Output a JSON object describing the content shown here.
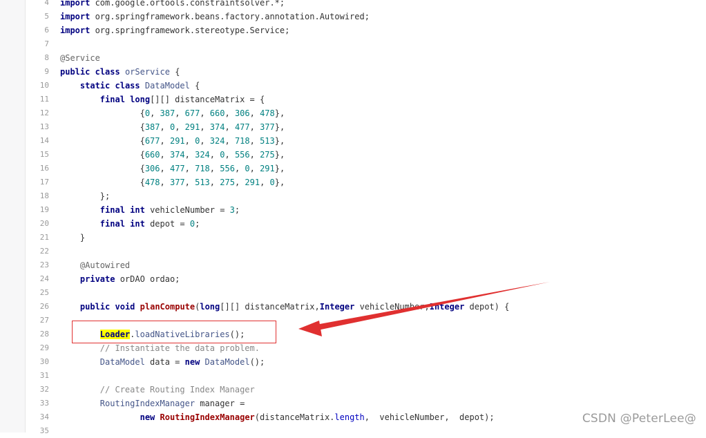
{
  "lines": [
    {
      "n": "4",
      "tokens": [
        {
          "t": "kw",
          "v": "import"
        },
        {
          "t": "plain",
          "v": " com.google.ortools.constraintsolver.*;"
        }
      ]
    },
    {
      "n": "5",
      "tokens": [
        {
          "t": "kw",
          "v": "import"
        },
        {
          "t": "plain",
          "v": " org.springframework.beans.factory.annotation.Autowired;"
        }
      ]
    },
    {
      "n": "6",
      "tokens": [
        {
          "t": "kw",
          "v": "import"
        },
        {
          "t": "plain",
          "v": " org.springframework.stereotype.Service;"
        }
      ]
    },
    {
      "n": "7",
      "tokens": []
    },
    {
      "n": "8",
      "tokens": [
        {
          "t": "ann",
          "v": "@Service"
        }
      ]
    },
    {
      "n": "9",
      "tokens": [
        {
          "t": "kw",
          "v": "public"
        },
        {
          "t": "plain",
          "v": " "
        },
        {
          "t": "kw",
          "v": "class"
        },
        {
          "t": "plain",
          "v": " "
        },
        {
          "t": "cls",
          "v": "orService"
        },
        {
          "t": "plain",
          "v": " {"
        }
      ]
    },
    {
      "n": "10",
      "tokens": [
        {
          "t": "plain",
          "v": "    "
        },
        {
          "t": "kw",
          "v": "static"
        },
        {
          "t": "plain",
          "v": " "
        },
        {
          "t": "kw",
          "v": "class"
        },
        {
          "t": "plain",
          "v": " "
        },
        {
          "t": "cls",
          "v": "DataModel"
        },
        {
          "t": "plain",
          "v": " {"
        }
      ]
    },
    {
      "n": "11",
      "tokens": [
        {
          "t": "plain",
          "v": "        "
        },
        {
          "t": "kw",
          "v": "final"
        },
        {
          "t": "plain",
          "v": " "
        },
        {
          "t": "type",
          "v": "long"
        },
        {
          "t": "plain",
          "v": "[][] distanceMatrix = {"
        }
      ]
    },
    {
      "n": "12",
      "tokens": [
        {
          "t": "plain",
          "v": "                {"
        },
        {
          "t": "num",
          "v": "0"
        },
        {
          "t": "plain",
          "v": ", "
        },
        {
          "t": "num",
          "v": "387"
        },
        {
          "t": "plain",
          "v": ", "
        },
        {
          "t": "num",
          "v": "677"
        },
        {
          "t": "plain",
          "v": ", "
        },
        {
          "t": "num",
          "v": "660"
        },
        {
          "t": "plain",
          "v": ", "
        },
        {
          "t": "num",
          "v": "306"
        },
        {
          "t": "plain",
          "v": ", "
        },
        {
          "t": "num",
          "v": "478"
        },
        {
          "t": "plain",
          "v": "},"
        }
      ]
    },
    {
      "n": "13",
      "tokens": [
        {
          "t": "plain",
          "v": "                {"
        },
        {
          "t": "num",
          "v": "387"
        },
        {
          "t": "plain",
          "v": ", "
        },
        {
          "t": "num",
          "v": "0"
        },
        {
          "t": "plain",
          "v": ", "
        },
        {
          "t": "num",
          "v": "291"
        },
        {
          "t": "plain",
          "v": ", "
        },
        {
          "t": "num",
          "v": "374"
        },
        {
          "t": "plain",
          "v": ", "
        },
        {
          "t": "num",
          "v": "477"
        },
        {
          "t": "plain",
          "v": ", "
        },
        {
          "t": "num",
          "v": "377"
        },
        {
          "t": "plain",
          "v": "},"
        }
      ]
    },
    {
      "n": "14",
      "tokens": [
        {
          "t": "plain",
          "v": "                {"
        },
        {
          "t": "num",
          "v": "677"
        },
        {
          "t": "plain",
          "v": ", "
        },
        {
          "t": "num",
          "v": "291"
        },
        {
          "t": "plain",
          "v": ", "
        },
        {
          "t": "num",
          "v": "0"
        },
        {
          "t": "plain",
          "v": ", "
        },
        {
          "t": "num",
          "v": "324"
        },
        {
          "t": "plain",
          "v": ", "
        },
        {
          "t": "num",
          "v": "718"
        },
        {
          "t": "plain",
          "v": ", "
        },
        {
          "t": "num",
          "v": "513"
        },
        {
          "t": "plain",
          "v": "},"
        }
      ]
    },
    {
      "n": "15",
      "tokens": [
        {
          "t": "plain",
          "v": "                {"
        },
        {
          "t": "num",
          "v": "660"
        },
        {
          "t": "plain",
          "v": ", "
        },
        {
          "t": "num",
          "v": "374"
        },
        {
          "t": "plain",
          "v": ", "
        },
        {
          "t": "num",
          "v": "324"
        },
        {
          "t": "plain",
          "v": ", "
        },
        {
          "t": "num",
          "v": "0"
        },
        {
          "t": "plain",
          "v": ", "
        },
        {
          "t": "num",
          "v": "556"
        },
        {
          "t": "plain",
          "v": ", "
        },
        {
          "t": "num",
          "v": "275"
        },
        {
          "t": "plain",
          "v": "},"
        }
      ]
    },
    {
      "n": "16",
      "tokens": [
        {
          "t": "plain",
          "v": "                {"
        },
        {
          "t": "num",
          "v": "306"
        },
        {
          "t": "plain",
          "v": ", "
        },
        {
          "t": "num",
          "v": "477"
        },
        {
          "t": "plain",
          "v": ", "
        },
        {
          "t": "num",
          "v": "718"
        },
        {
          "t": "plain",
          "v": ", "
        },
        {
          "t": "num",
          "v": "556"
        },
        {
          "t": "plain",
          "v": ", "
        },
        {
          "t": "num",
          "v": "0"
        },
        {
          "t": "plain",
          "v": ", "
        },
        {
          "t": "num",
          "v": "291"
        },
        {
          "t": "plain",
          "v": "},"
        }
      ]
    },
    {
      "n": "17",
      "tokens": [
        {
          "t": "plain",
          "v": "                {"
        },
        {
          "t": "num",
          "v": "478"
        },
        {
          "t": "plain",
          "v": ", "
        },
        {
          "t": "num",
          "v": "377"
        },
        {
          "t": "plain",
          "v": ", "
        },
        {
          "t": "num",
          "v": "513"
        },
        {
          "t": "plain",
          "v": ", "
        },
        {
          "t": "num",
          "v": "275"
        },
        {
          "t": "plain",
          "v": ", "
        },
        {
          "t": "num",
          "v": "291"
        },
        {
          "t": "plain",
          "v": ", "
        },
        {
          "t": "num",
          "v": "0"
        },
        {
          "t": "plain",
          "v": "},"
        }
      ]
    },
    {
      "n": "18",
      "tokens": [
        {
          "t": "plain",
          "v": "        };"
        }
      ]
    },
    {
      "n": "19",
      "tokens": [
        {
          "t": "plain",
          "v": "        "
        },
        {
          "t": "kw",
          "v": "final"
        },
        {
          "t": "plain",
          "v": " "
        },
        {
          "t": "type",
          "v": "int"
        },
        {
          "t": "plain",
          "v": " vehicleNumber = "
        },
        {
          "t": "num",
          "v": "3"
        },
        {
          "t": "plain",
          "v": ";"
        }
      ]
    },
    {
      "n": "20",
      "tokens": [
        {
          "t": "plain",
          "v": "        "
        },
        {
          "t": "kw",
          "v": "final"
        },
        {
          "t": "plain",
          "v": " "
        },
        {
          "t": "type",
          "v": "int"
        },
        {
          "t": "plain",
          "v": " depot = "
        },
        {
          "t": "num",
          "v": "0"
        },
        {
          "t": "plain",
          "v": ";"
        }
      ]
    },
    {
      "n": "21",
      "tokens": [
        {
          "t": "plain",
          "v": "    }"
        }
      ]
    },
    {
      "n": "22",
      "tokens": []
    },
    {
      "n": "23",
      "tokens": [
        {
          "t": "plain",
          "v": "    "
        },
        {
          "t": "ann",
          "v": "@Autowired"
        }
      ]
    },
    {
      "n": "24",
      "tokens": [
        {
          "t": "plain",
          "v": "    "
        },
        {
          "t": "kw",
          "v": "private"
        },
        {
          "t": "plain",
          "v": " orDAO ordao;"
        }
      ]
    },
    {
      "n": "25",
      "tokens": []
    },
    {
      "n": "26",
      "tokens": [
        {
          "t": "plain",
          "v": "    "
        },
        {
          "t": "kw",
          "v": "public"
        },
        {
          "t": "plain",
          "v": " "
        },
        {
          "t": "type",
          "v": "void"
        },
        {
          "t": "plain",
          "v": " "
        },
        {
          "t": "fn",
          "v": "planCompute"
        },
        {
          "t": "plain",
          "v": "("
        },
        {
          "t": "type",
          "v": "long"
        },
        {
          "t": "plain",
          "v": "[][] distanceMatrix,"
        },
        {
          "t": "type",
          "v": "Integer"
        },
        {
          "t": "plain",
          "v": " vehicleNumber,"
        },
        {
          "t": "type",
          "v": "Integer"
        },
        {
          "t": "plain",
          "v": " depot) {"
        }
      ]
    },
    {
      "n": "27",
      "tokens": []
    },
    {
      "n": "28",
      "tokens": [
        {
          "t": "plain",
          "v": "        "
        },
        {
          "t": "hl",
          "v": "Loader"
        },
        {
          "t": "plain",
          "v": "."
        },
        {
          "t": "cls",
          "v": "loadNativeLibraries"
        },
        {
          "t": "plain",
          "v": "();"
        }
      ]
    },
    {
      "n": "29",
      "tokens": [
        {
          "t": "plain",
          "v": "        "
        },
        {
          "t": "comment",
          "v": "// Instantiate the data problem."
        }
      ]
    },
    {
      "n": "30",
      "tokens": [
        {
          "t": "plain",
          "v": "        "
        },
        {
          "t": "cls",
          "v": "DataModel"
        },
        {
          "t": "plain",
          "v": " data = "
        },
        {
          "t": "kw",
          "v": "new"
        },
        {
          "t": "plain",
          "v": " "
        },
        {
          "t": "cls",
          "v": "DataModel"
        },
        {
          "t": "plain",
          "v": "();"
        }
      ]
    },
    {
      "n": "31",
      "tokens": []
    },
    {
      "n": "32",
      "tokens": [
        {
          "t": "plain",
          "v": "        "
        },
        {
          "t": "comment",
          "v": "// Create Routing Index Manager"
        }
      ]
    },
    {
      "n": "33",
      "tokens": [
        {
          "t": "plain",
          "v": "        "
        },
        {
          "t": "cls",
          "v": "RoutingIndexManager"
        },
        {
          "t": "plain",
          "v": " manager ="
        }
      ]
    },
    {
      "n": "34",
      "tokens": [
        {
          "t": "plain",
          "v": "                "
        },
        {
          "t": "kw",
          "v": "new"
        },
        {
          "t": "plain",
          "v": " "
        },
        {
          "t": "fn",
          "v": "RoutingIndexManager"
        },
        {
          "t": "plain",
          "v": "(distanceMatrix."
        },
        {
          "t": "field",
          "v": "length"
        },
        {
          "t": "plain",
          "v": ",  vehicleNumber,  depot);"
        }
      ]
    },
    {
      "n": "35",
      "tokens": []
    }
  ],
  "watermark": "CSDN @PeterLee@",
  "colors": {
    "highlight_box": "#e03030",
    "arrow": "#e03030",
    "highlight_bg": "#ffff00"
  }
}
